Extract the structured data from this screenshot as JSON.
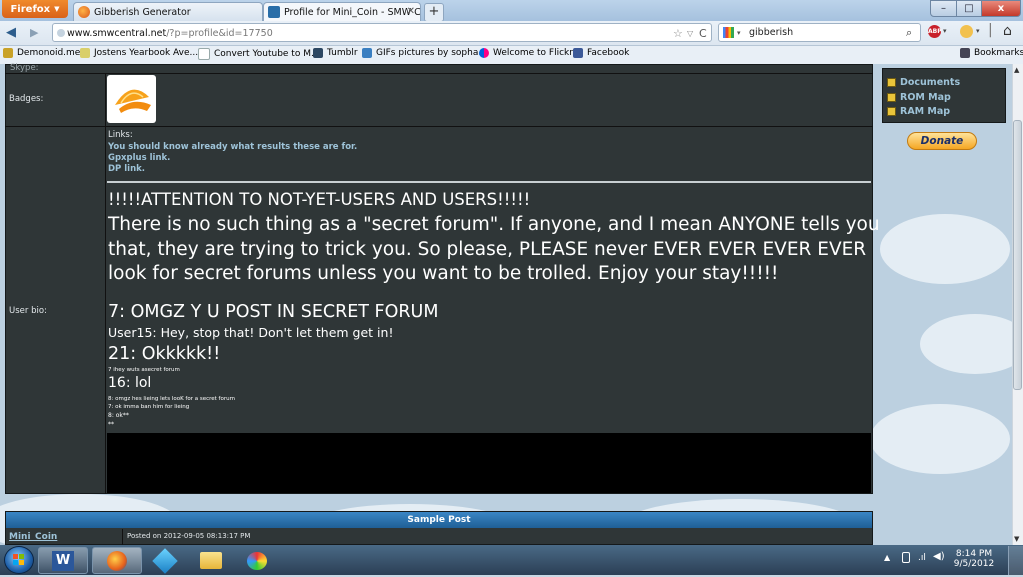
{
  "browser": {
    "app_button": "Firefox",
    "tabs": [
      {
        "label": "Gibberish Generator",
        "icon": "firefox-icon",
        "active": false
      },
      {
        "label": "Profile for Mini_Coin - SMW Central",
        "icon": "smw-central-icon",
        "active": true
      }
    ],
    "new_tab": "+",
    "window_buttons": {
      "minimize": "–",
      "maximize": "□",
      "close": "x"
    },
    "url": {
      "domain": "www.smwcentral.net",
      "path": "/?p=profile&id=17750"
    },
    "search": {
      "value": "gibberish"
    },
    "bookmarks_menu": "Bookmarks",
    "bookmarks": [
      {
        "label": "Demonoid.me",
        "color": "#c9a227"
      },
      {
        "label": "Jostens Yearbook Ave...",
        "color": "#d9cf6a"
      },
      {
        "label": "Convert Youtube to M...",
        "color": "#c9d6e2"
      },
      {
        "label": "Tumblr",
        "color": "#2c4762"
      },
      {
        "label": "GIFs pictures by sopha...",
        "color": "#3a7fc1"
      },
      {
        "label": "Welcome to Flickr!",
        "color": "#ff0084"
      },
      {
        "label": "Facebook",
        "color": "#3b5998"
      }
    ]
  },
  "profile": {
    "cut_label": "Skype:",
    "badges_label": "Badges:",
    "bio_label": "User bio:",
    "links_heading": "Links:",
    "links": [
      "You should know already what results these are for.",
      "Gpxplus link.",
      "DP link."
    ],
    "attention": "!!!!!ATTENTION TO NOT-YET-USERS AND USERS!!!!!",
    "warning_lines": [
      "There is no such thing as a \"secret forum\". If anyone, and I mean ANYONE tells you",
      "that, they are trying to trick you. So please, PLEASE never EVER EVER EVER EVER",
      "look for secret forums unless you want to be trolled. Enjoy your stay!!!!!"
    ],
    "chat": {
      "line1": "7: OMGZ Y U POST IN SECRET FORUM",
      "line2": "User15: Hey, stop that! Don't let them get in!",
      "line3": "21: Okkkkk!!",
      "line4": "7 ihey wuts asecret forum",
      "line5": "16: lol",
      "line6": "8: omgz hes lieing lets looK for a secret forum",
      "line7": "7: ok imma ban him for lieing",
      "line8": "8: ok**",
      "line9": "**"
    }
  },
  "sidebar": {
    "links": [
      "Documents",
      "ROM Map",
      "RAM Map"
    ],
    "donate": "Donate"
  },
  "sample_post": {
    "header": "Sample Post",
    "username": "Mini_Coin",
    "posted": "Posted on 2012-09-05 08:13:17 PM"
  },
  "taskbar": {
    "time": "8:14 PM",
    "date": "9/5/2012"
  },
  "colors": {
    "panel": "#2f3637",
    "link": "#9ec3d8",
    "header_bar": "#2a6ea8"
  }
}
